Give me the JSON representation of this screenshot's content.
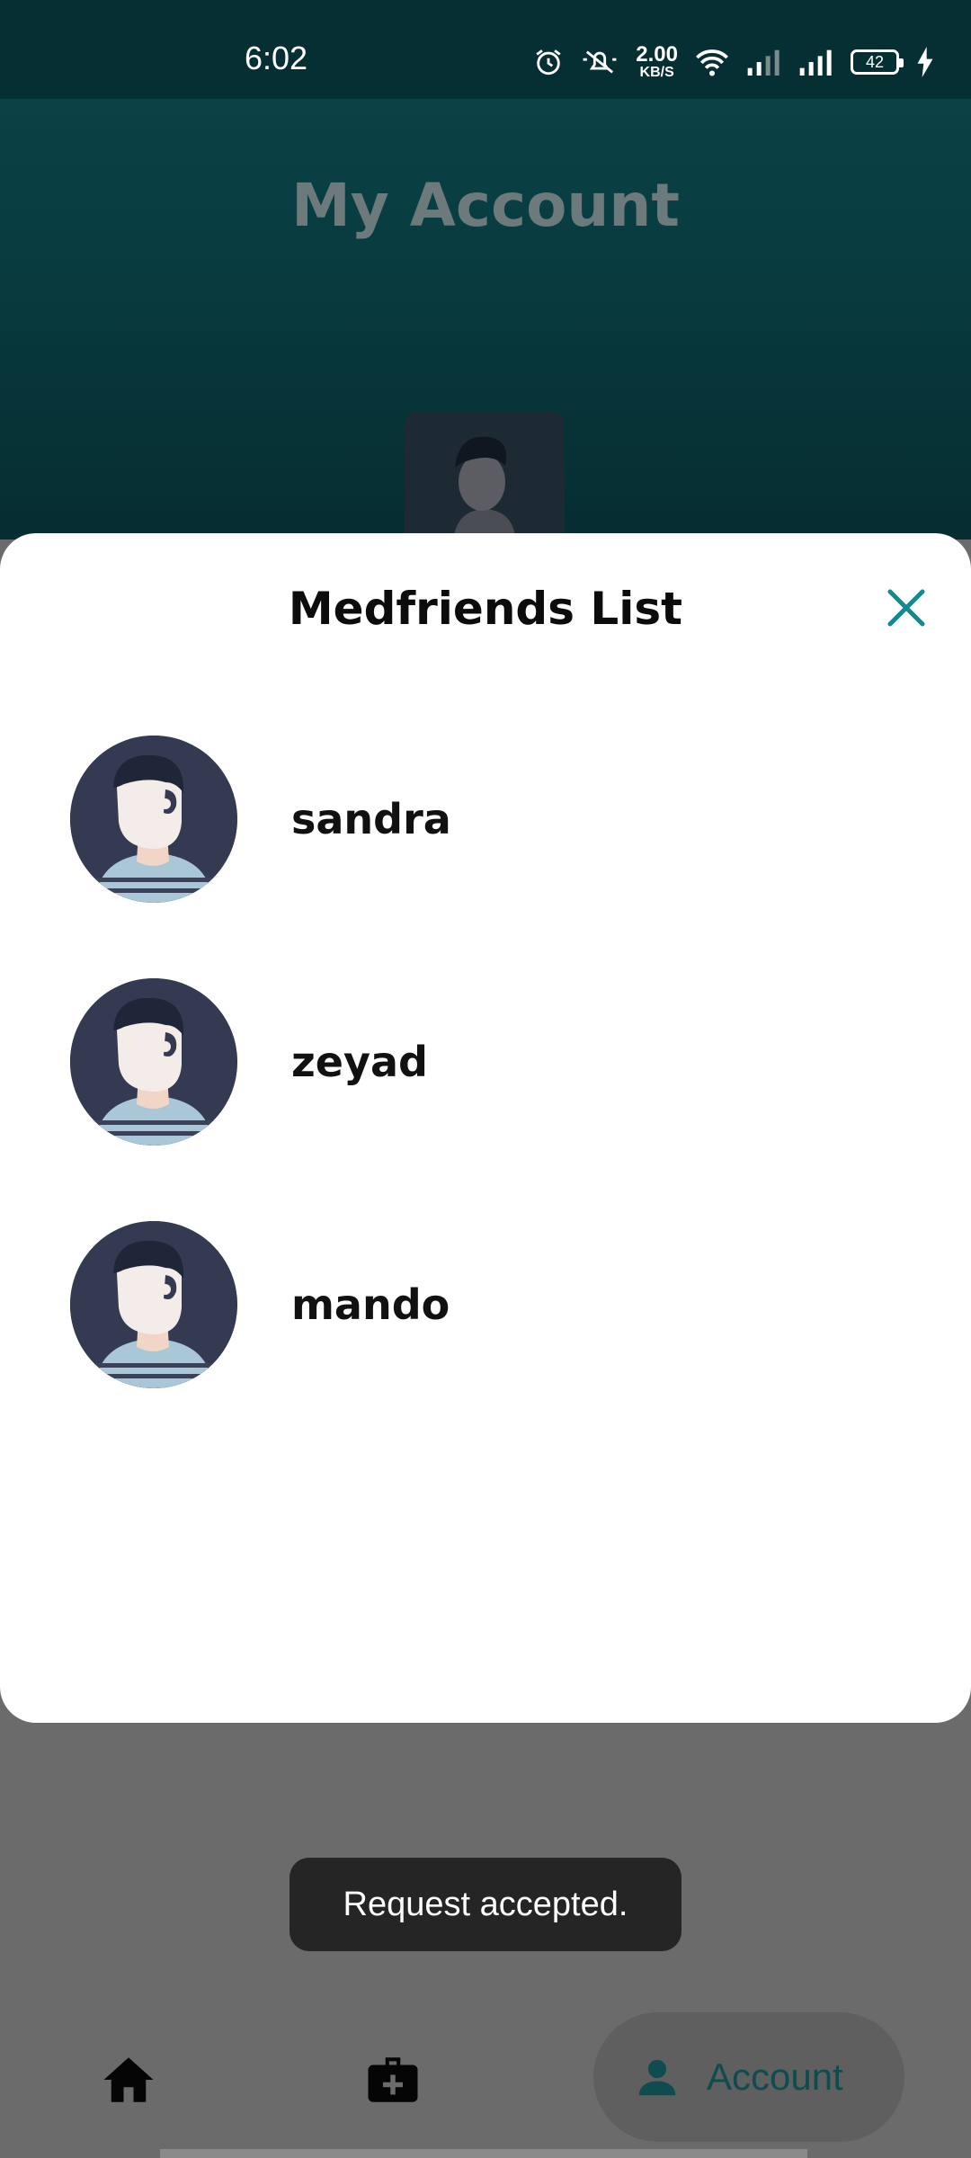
{
  "status_bar": {
    "time": "6:02",
    "net_speed_value": "2.00",
    "net_speed_unit": "KB/S",
    "battery_level": "42",
    "icons": [
      "alarm-icon",
      "mute-icon",
      "wifi-icon",
      "signal-weak-icon",
      "signal-strong-icon",
      "battery-icon",
      "charging-icon"
    ]
  },
  "background": {
    "title": "My Account"
  },
  "modal": {
    "title": "Medfriends List",
    "close_icon": "close-icon",
    "friends": [
      {
        "name": "sandra"
      },
      {
        "name": "zeyad"
      },
      {
        "name": "mando"
      }
    ]
  },
  "toast": {
    "message": "Request accepted."
  },
  "bottom_nav": {
    "home_icon": "home-icon",
    "medical_icon": "medical-kit-icon",
    "account_label": "Account",
    "account_icon": "person-icon"
  },
  "colors": {
    "accent": "#138a91",
    "header_dark": "#062f33",
    "scrim": "#6b6b6b"
  }
}
